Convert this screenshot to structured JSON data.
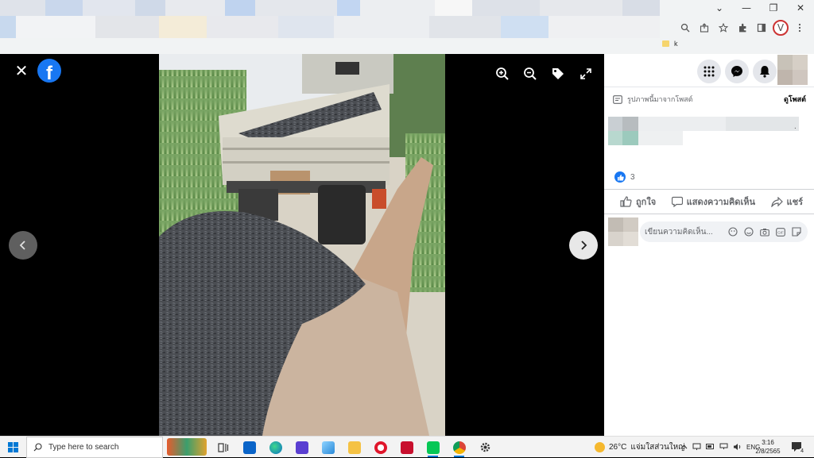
{
  "browser": {
    "window_controls": {
      "minimize": "—",
      "maximize": "❐",
      "close": "✕",
      "menu": "⌄"
    },
    "bookmark": {
      "label": "k"
    },
    "toolbar_icons": [
      "zoom-icon",
      "share-icon",
      "star-icon",
      "extensions-icon",
      "sidebar-icon",
      "profile-icon",
      "kebab-menu-icon"
    ],
    "profile_letter": "V"
  },
  "viewer": {
    "close_symbol": "✕",
    "logo_letter": "f",
    "tools": [
      "zoom-in-icon",
      "zoom-out-icon",
      "tag-icon",
      "fullscreen-icon"
    ]
  },
  "sidebar": {
    "post_source_label": "รูปภาพนี้มาจากโพสต์",
    "view_post_link": "ดูโพสต์",
    "caption_end": ".",
    "reaction_count": "3",
    "actions": {
      "like": "ถูกใจ",
      "comment": "แสดงความคิดเห็น",
      "share": "แชร์"
    },
    "comment_placeholder": "เขียนความคิดเห็น..."
  },
  "taskbar": {
    "search_placeholder": "Type here to search",
    "weather_temp": "26°C",
    "weather_text": "แจ่มใสส่วนใหญ่",
    "lang": "ENG",
    "time": "3:16",
    "date": "2/8/2565",
    "notification_count": "4"
  },
  "colors": {
    "facebook_blue": "#1877f2",
    "viewer_bg": "#000000",
    "taskbar_bg": "#f3f3f3"
  }
}
